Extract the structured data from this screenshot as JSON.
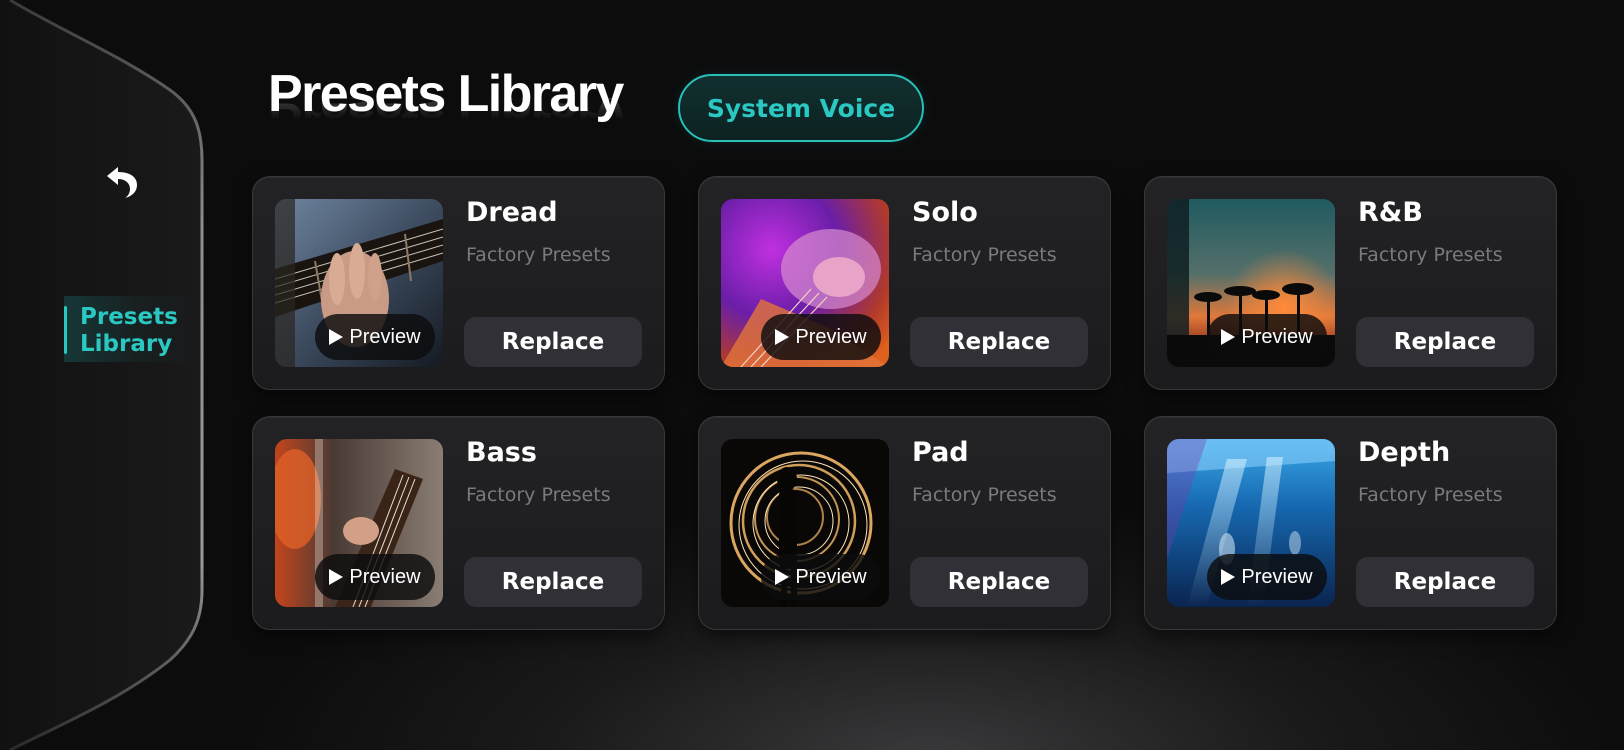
{
  "sidebar": {
    "back_icon": "undo-arrow-icon",
    "items": [
      {
        "label": "Presets Library",
        "active": true,
        "accent": "#2bc8c3"
      }
    ]
  },
  "header": {
    "title": "Presets Library",
    "voice_button_label": "System Voice",
    "accent": "#2bc8c3"
  },
  "presets": [
    {
      "name": "Dread",
      "subtitle": "Factory Presets",
      "preview_label": "Preview",
      "replace_label": "Replace",
      "image": "guitar-fretboard-photo"
    },
    {
      "name": "Solo",
      "subtitle": "Factory Presets",
      "preview_label": "Preview",
      "replace_label": "Replace",
      "image": "guitarist-purple-stage-photo"
    },
    {
      "name": "R&B",
      "subtitle": "Factory Presets",
      "preview_label": "Preview",
      "replace_label": "Replace",
      "image": "palm-sunset-photo"
    },
    {
      "name": "Bass",
      "subtitle": "Factory Presets",
      "preview_label": "Preview",
      "replace_label": "Replace",
      "image": "bass-player-orange-photo"
    },
    {
      "name": "Pad",
      "subtitle": "Factory Presets",
      "preview_label": "Preview",
      "replace_label": "Replace",
      "image": "fire-spin-silhouette-photo"
    },
    {
      "name": "Depth",
      "subtitle": "Factory Presets",
      "preview_label": "Preview",
      "replace_label": "Replace",
      "image": "underwater-swimmer-photo"
    }
  ],
  "colors": {
    "background": "#0c0c0d",
    "card": "#1f1f21",
    "button": "#303036",
    "muted_text": "#7a7a7e"
  }
}
